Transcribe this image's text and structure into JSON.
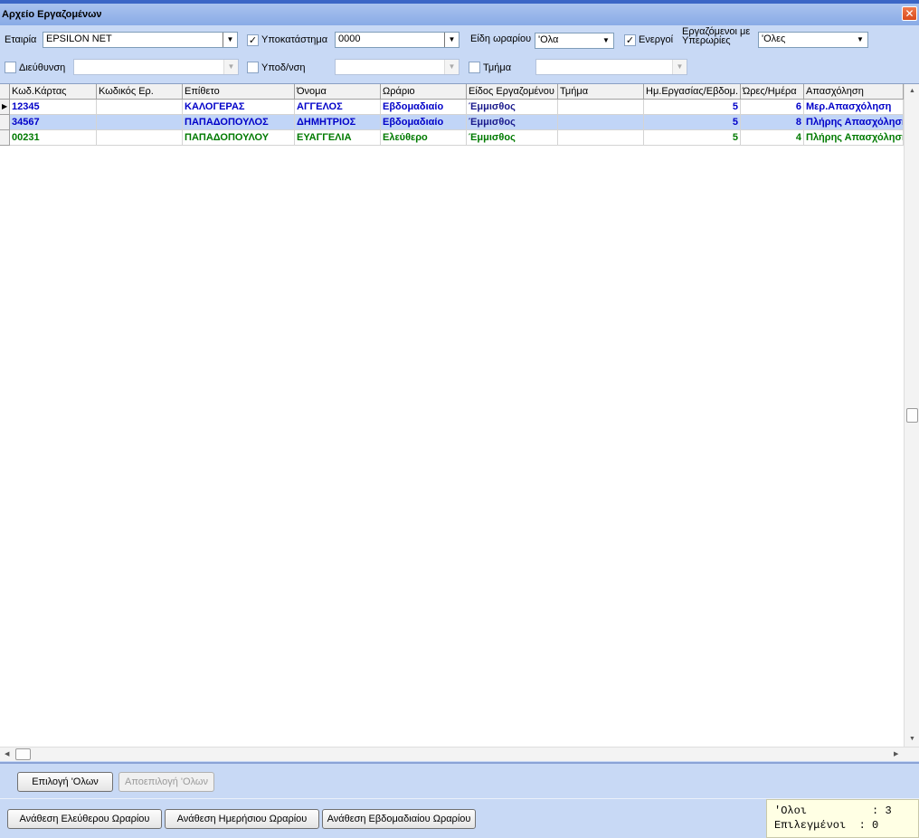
{
  "window": {
    "title": "Αρχείο Εργαζομένων",
    "close": "✕"
  },
  "filters": {
    "company_label": "Εταιρία",
    "company_value": "EPSILON NET",
    "branch_label": "Υποκατάστημα",
    "branch_checked": true,
    "branch_value": "0000",
    "schedule_types_label": "Είδη ωραρίου",
    "schedule_types_value": "'Ολα",
    "active_label": "Ενεργοί",
    "active_checked": true,
    "overtime_label": "Εργαζόμενοι με Υπερωρίες",
    "overtime_value": "'Ολες",
    "direction_label": "Διεύθυνση",
    "subdirection_label": "Υποδ/νση",
    "department_label": "Τμήμα",
    "check_mark": "✓",
    "arrow": "▼"
  },
  "grid": {
    "columns": [
      "Κωδ.Κάρτας",
      "Κωδικός Ερ.",
      "Επίθετο",
      "Όνομα",
      "Ωράριο",
      "Είδος Εργαζομένου",
      "Τμήμα",
      "Ημ.Εργασίας/Εβδομ.",
      "Ώρες/Ημέρα",
      "Απασχόληση"
    ],
    "rows": [
      {
        "color": "#0000c8",
        "cells": [
          "12345",
          "",
          "ΚΑΛΟΓΕΡΑΣ",
          "ΑΓΓΕΛΟΣ",
          "Εβδομαδιαίο",
          "Έμμισθος",
          "",
          "5",
          "6",
          "Μερ.Απασχόληση"
        ]
      },
      {
        "color": "#0000c8",
        "cells": [
          "34567",
          "",
          "ΠΑΠΑΔΟΠΟΥΛΟΣ",
          "ΔΗΜΗΤΡΙΟΣ",
          "Εβδομαδιαίο",
          "Έμμισθος",
          "",
          "5",
          "8",
          "Πλήρης Απασχόληση"
        ]
      },
      {
        "color": "#007a00",
        "cells": [
          "00231",
          "",
          "ΠΑΠΑΔΟΠΟΥΛΟΥ",
          "ΕΥΑΓΓΕΛΙΑ",
          "Ελεύθερο",
          "Έμμισθος",
          "",
          "5",
          "4",
          "Πλήρης Απασχόληση"
        ]
      }
    ],
    "selected_row": 1,
    "row_pointer": "▶"
  },
  "buttons": {
    "select_all": "Επιλογή 'Ολων",
    "deselect_all": "Αποεπιλογή 'Ολων",
    "assign_free": "Ανάθεση Ελεύθερου Ωραρίου",
    "assign_daily": "Ανάθεση Ημερήσιου Ωραρίου",
    "assign_weekly": "Ανάθεση Εβδομαδιαίου Ωραρίου"
  },
  "status": {
    "all_label": "'Ολοι",
    "all_value": "3",
    "selected_label": "Επιλεγμένοι",
    "selected_value": "0"
  }
}
